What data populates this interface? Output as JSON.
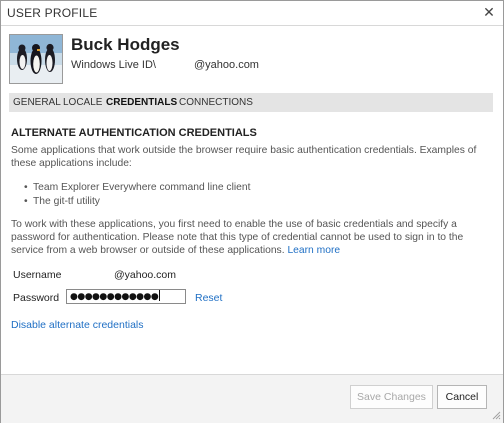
{
  "window": {
    "title": "USER PROFILE",
    "close_glyph": "✕"
  },
  "profile": {
    "avatar_icon": "penguins-avatar-icon",
    "name": "Buck Hodges",
    "id_prefix": "Windows Live ID\\",
    "id_email": "@yahoo.com"
  },
  "tabs": [
    {
      "label": "GENERAL",
      "active": false
    },
    {
      "label": "LOCALE",
      "active": false
    },
    {
      "label": "CREDENTIALS",
      "active": true
    },
    {
      "label": "CONNECTIONS",
      "active": false
    }
  ],
  "credentials": {
    "heading": "ALTERNATE AUTHENTICATION CREDENTIALS",
    "intro": "Some applications that work outside the browser require basic authentication credentials. Examples of these applications include:",
    "examples": [
      "Team Explorer Everywhere command line client",
      "The git-tf utility"
    ],
    "explanation": "To work with these applications, you first need to enable the use of basic credentials and specify a password for authentication. Please note that this type of credential cannot be used to sign in to the service from a web browser or outside of these applications.",
    "learn_more": "Learn more",
    "username_label": "Username",
    "username_value": "@yahoo.com",
    "password_label": "Password",
    "password_mask": "●●●●●●●●●●●●",
    "reset_link": "Reset",
    "disable_link": "Disable alternate credentials"
  },
  "footer": {
    "save_label": "Save Changes",
    "save_enabled": false,
    "cancel_label": "Cancel"
  },
  "colors": {
    "link": "#1f6fc4",
    "tab_bar": "#e4e4e4",
    "footer_bg": "#f3f3f3"
  }
}
